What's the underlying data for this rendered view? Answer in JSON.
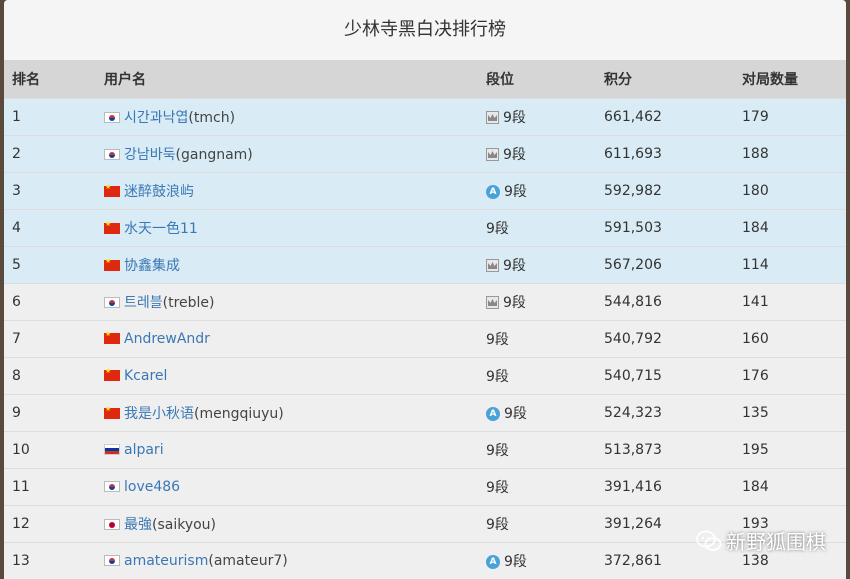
{
  "title": "少林寺黑白决排行榜",
  "headers": [
    "排名",
    "用户名",
    "段位",
    "积分",
    "对局数量"
  ],
  "rows": [
    {
      "rank": "1",
      "flag": "kr",
      "name": "시간과낙엽",
      "handle": "(tmch)",
      "dan_icon": "crown-icon",
      "dan": "9段",
      "score": "661,462",
      "games": "179",
      "highlight": true
    },
    {
      "rank": "2",
      "flag": "kr",
      "name": "강남바둑",
      "handle": "(gangnam)",
      "dan_icon": "crown-icon",
      "dan": "9段",
      "score": "611,693",
      "games": "188",
      "highlight": true
    },
    {
      "rank": "3",
      "flag": "cn",
      "name": "迷醉鼓浪屿",
      "handle": "",
      "dan_icon": "a-badge-icon",
      "dan": "9段",
      "score": "592,982",
      "games": "180",
      "highlight": true
    },
    {
      "rank": "4",
      "flag": "cn",
      "name": "水天一色11",
      "handle": "",
      "dan_icon": "",
      "dan": "9段",
      "score": "591,503",
      "games": "184",
      "highlight": true
    },
    {
      "rank": "5",
      "flag": "cn",
      "name": "协鑫集成",
      "handle": "",
      "dan_icon": "crown-icon",
      "dan": "9段",
      "score": "567,206",
      "games": "114",
      "highlight": true
    },
    {
      "rank": "6",
      "flag": "kr",
      "name": "트레블",
      "handle": "(treble)",
      "dan_icon": "crown-icon",
      "dan": "9段",
      "score": "544,816",
      "games": "141",
      "highlight": false
    },
    {
      "rank": "7",
      "flag": "cn",
      "name": "AndrewAndr",
      "handle": "",
      "dan_icon": "",
      "dan": "9段",
      "score": "540,792",
      "games": "160",
      "highlight": false
    },
    {
      "rank": "8",
      "flag": "cn",
      "name": "Kcarel",
      "handle": "",
      "dan_icon": "",
      "dan": "9段",
      "score": "540,715",
      "games": "176",
      "highlight": false
    },
    {
      "rank": "9",
      "flag": "cn",
      "name": "我是小秋语",
      "handle": "(mengqiuyu)",
      "dan_icon": "a-badge-icon",
      "dan": "9段",
      "score": "524,323",
      "games": "135",
      "highlight": false
    },
    {
      "rank": "10",
      "flag": "ru",
      "name": "alpari",
      "handle": "",
      "dan_icon": "",
      "dan": "9段",
      "score": "513,873",
      "games": "195",
      "highlight": false
    },
    {
      "rank": "11",
      "flag": "kr",
      "name": "love486",
      "handle": "",
      "dan_icon": "",
      "dan": "9段",
      "score": "391,416",
      "games": "184",
      "highlight": false
    },
    {
      "rank": "12",
      "flag": "jp",
      "name": "最強",
      "handle": "(saikyou)",
      "dan_icon": "",
      "dan": "9段",
      "score": "391,264",
      "games": "193",
      "highlight": false
    },
    {
      "rank": "13",
      "flag": "kr",
      "name": "amateurism",
      "handle": "(amateur7)",
      "dan_icon": "a-badge-icon",
      "dan": "9段",
      "score": "372,861",
      "games": "138",
      "highlight": false
    }
  ],
  "watermark": "新野狐围棋",
  "badge_letter": "A",
  "colors": {
    "highlight_row": "#d9ecf5",
    "link": "#3a78b5"
  }
}
